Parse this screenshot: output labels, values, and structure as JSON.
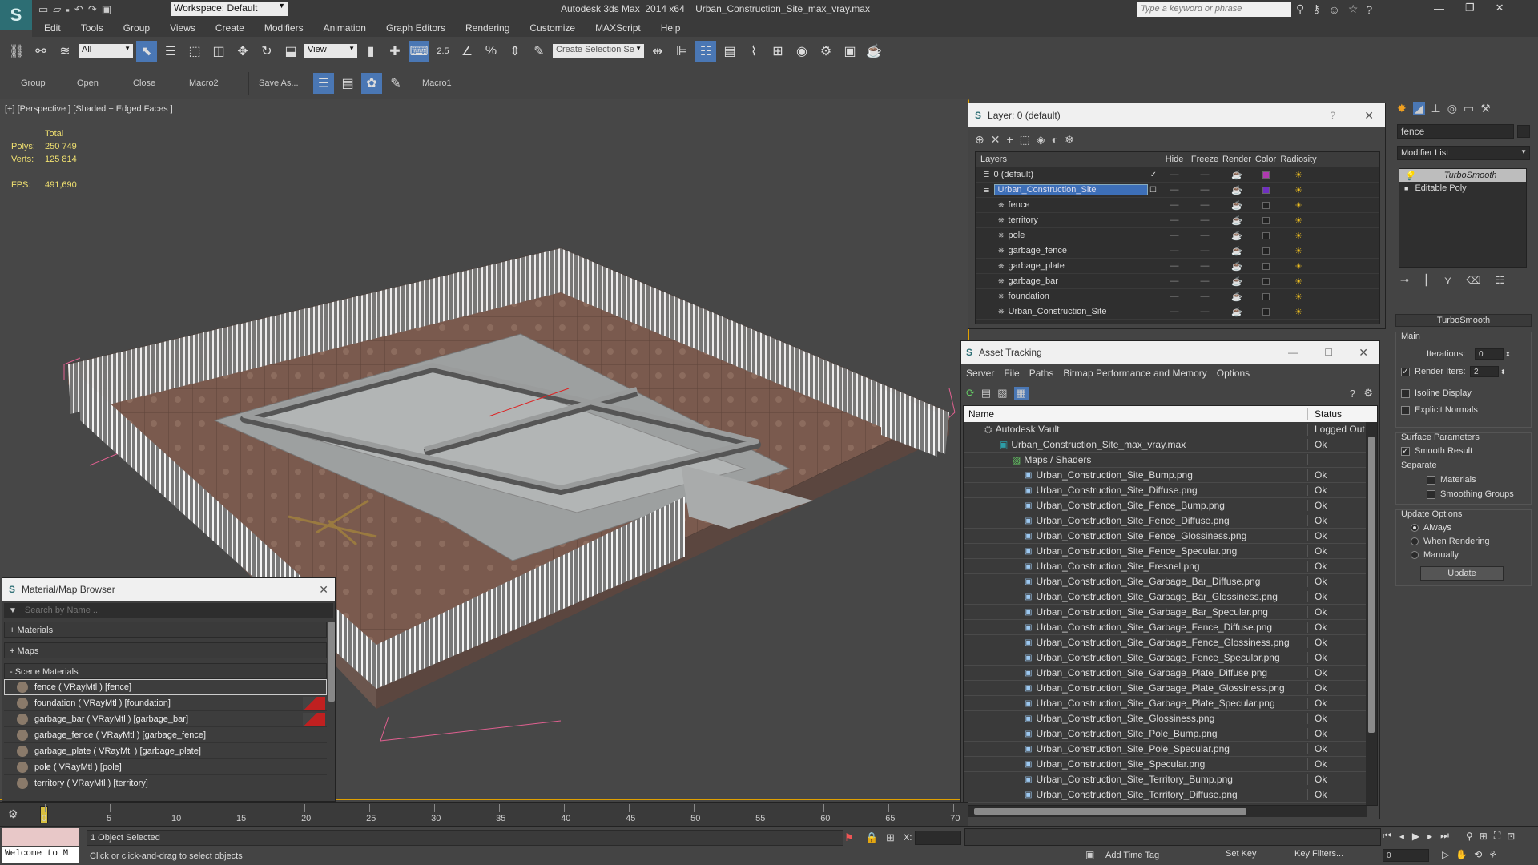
{
  "app": {
    "title": "Autodesk 3ds Max  2014 x64    Urban_Construction_Site_max_vray.max",
    "workspace": "Workspace: Default",
    "search_placeholder": "Type a keyword or phrase"
  },
  "menu": [
    "Edit",
    "Tools",
    "Group",
    "Views",
    "Create",
    "Modifiers",
    "Animation",
    "Graph Editors",
    "Rendering",
    "Customize",
    "MAXScript",
    "Help"
  ],
  "toolbar": {
    "filter_select": "All",
    "view_select": "View",
    "selection_set": "Create Selection Se",
    "snap_label": "2.5"
  },
  "quickbar": [
    "Group",
    "Open",
    "Close",
    "Macro2",
    "Save As...",
    "Macro1"
  ],
  "viewport": {
    "label": "[+] [Perspective ] [Shaded + Edged Faces ]",
    "stats": {
      "total_label": "Total",
      "polys_label": "Polys:",
      "polys": "250 749",
      "verts_label": "Verts:",
      "verts": "125 814",
      "fps_label": "FPS:",
      "fps": "491,690"
    }
  },
  "layer_dialog": {
    "title": "Layer: 0 (default)",
    "help": "?",
    "columns": [
      "Layers",
      "Hide",
      "Freeze",
      "Render",
      "Color",
      "Radiosity"
    ],
    "rows": [
      {
        "name": "0 (default)",
        "level": 0,
        "color": "#b03ab0",
        "selected": false
      },
      {
        "name": "Urban_Construction_Site",
        "level": 0,
        "color": "#7030c0",
        "selected": true
      },
      {
        "name": "fence",
        "level": 1,
        "color": "#222222",
        "selected": false
      },
      {
        "name": "territory",
        "level": 1,
        "color": "#222222",
        "selected": false
      },
      {
        "name": "pole",
        "level": 1,
        "color": "#222222",
        "selected": false
      },
      {
        "name": "garbage_fence",
        "level": 1,
        "color": "#222222",
        "selected": false
      },
      {
        "name": "garbage_plate",
        "level": 1,
        "color": "#222222",
        "selected": false
      },
      {
        "name": "garbage_bar",
        "level": 1,
        "color": "#222222",
        "selected": false
      },
      {
        "name": "foundation",
        "level": 1,
        "color": "#222222",
        "selected": false
      },
      {
        "name": "Urban_Construction_Site",
        "level": 1,
        "color": "#222222",
        "selected": false
      }
    ]
  },
  "asset_tracking": {
    "title": "Asset Tracking",
    "menu": [
      "Server",
      "File",
      "Paths",
      "Bitmap Performance and Memory",
      "Options"
    ],
    "columns": [
      "Name",
      "Status"
    ],
    "vault": {
      "name": "Autodesk Vault",
      "status": "Logged Out"
    },
    "file": {
      "name": "Urban_Construction_Site_max_vray.max",
      "status": "Ok"
    },
    "group": {
      "name": "Maps / Shaders",
      "status": ""
    },
    "maps": [
      "Urban_Construction_Site_Bump.png",
      "Urban_Construction_Site_Diffuse.png",
      "Urban_Construction_Site_Fence_Bump.png",
      "Urban_Construction_Site_Fence_Diffuse.png",
      "Urban_Construction_Site_Fence_Glossiness.png",
      "Urban_Construction_Site_Fence_Specular.png",
      "Urban_Construction_Site_Fresnel.png",
      "Urban_Construction_Site_Garbage_Bar_Diffuse.png",
      "Urban_Construction_Site_Garbage_Bar_Glossiness.png",
      "Urban_Construction_Site_Garbage_Bar_Specular.png",
      "Urban_Construction_Site_Garbage_Fence_Diffuse.png",
      "Urban_Construction_Site_Garbage_Fence_Glossiness.png",
      "Urban_Construction_Site_Garbage_Fence_Specular.png",
      "Urban_Construction_Site_Garbage_Plate_Diffuse.png",
      "Urban_Construction_Site_Garbage_Plate_Glossiness.png",
      "Urban_Construction_Site_Garbage_Plate_Specular.png",
      "Urban_Construction_Site_Glossiness.png",
      "Urban_Construction_Site_Pole_Bump.png",
      "Urban_Construction_Site_Pole_Specular.png",
      "Urban_Construction_Site_Specular.png",
      "Urban_Construction_Site_Territory_Bump.png",
      "Urban_Construction_Site_Territory_Diffuse.png"
    ],
    "map_status": "Ok"
  },
  "material_browser": {
    "title": "Material/Map Browser",
    "search_placeholder": "Search by Name ...",
    "sections": [
      "+ Materials",
      "+ Maps",
      "- Scene Materials"
    ],
    "materials": [
      {
        "label": "fence ( VRayMtl ) [fence]",
        "warn": false
      },
      {
        "label": "foundation ( VRayMtl ) [foundation]",
        "warn": true
      },
      {
        "label": "garbage_bar ( VRayMtl ) [garbage_bar]",
        "warn": true
      },
      {
        "label": "garbage_fence ( VRayMtl ) [garbage_fence]",
        "warn": false
      },
      {
        "label": "garbage_plate ( VRayMtl ) [garbage_plate]",
        "warn": false
      },
      {
        "label": "pole ( VRayMtl ) [pole]",
        "warn": false
      },
      {
        "label": "territory ( VRayMtl ) [territory]",
        "warn": false
      }
    ]
  },
  "command_panel": {
    "object_name": "fence",
    "modifier_list": "Modifier List",
    "stack": [
      "TurboSmooth",
      "Editable Poly"
    ],
    "rollout_title": "TurboSmooth",
    "main_label": "Main",
    "iterations_label": "Iterations:",
    "iterations": "0",
    "render_iters_label": "Render Iters:",
    "render_iters": "2",
    "isoline": "Isoline Display",
    "explicit": "Explicit Normals",
    "surface_label": "Surface Parameters",
    "smooth_result": "Smooth Result",
    "separate_label": "Separate",
    "materials": "Materials",
    "smoothing_groups": "Smoothing Groups",
    "update_label": "Update Options",
    "always": "Always",
    "when_rendering": "When Rendering",
    "manually": "Manually",
    "update_button": "Update"
  },
  "timeline": {
    "ticks": [
      "0",
      "5",
      "10",
      "15",
      "20",
      "25",
      "30",
      "35",
      "40",
      "45",
      "50",
      "55",
      "60",
      "65",
      "70"
    ]
  },
  "status": {
    "welcome": "Welcome to M",
    "selected": "1 Object Selected",
    "prompt": "Click or click-and-drag to select objects",
    "x_label": "X:",
    "add_time_tag": "Add Time Tag",
    "set_key": "Set Key",
    "key_filters": "Key Filters...",
    "frame": "0"
  }
}
